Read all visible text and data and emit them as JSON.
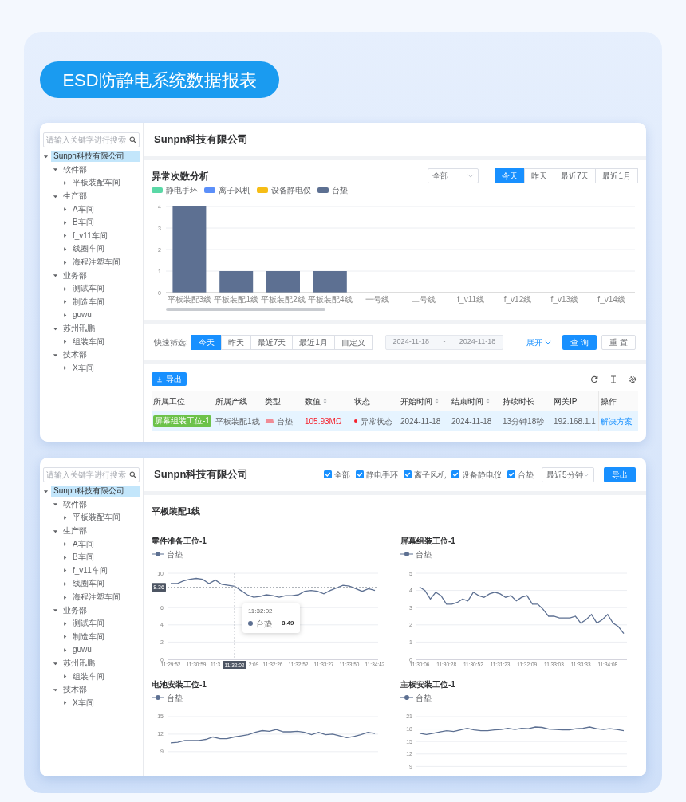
{
  "banner": {
    "title": "ESD防静电系统数据报表"
  },
  "screens": [
    {
      "kind": "analysis",
      "sidebar": {
        "search": {
          "placeholder": "请输入关键字进行搜索"
        },
        "tree": [
          {
            "label": "Sunpn科技有限公司",
            "expanded": true,
            "selected": true,
            "children": [
              {
                "label": "软件部",
                "expanded": true,
                "selected": false,
                "children": [
                  {
                    "label": "平板装配车间",
                    "expanded": false,
                    "selected": false
                  }
                ]
              },
              {
                "label": "生产部",
                "expanded": true,
                "selected": false,
                "children": [
                  {
                    "label": "A车间",
                    "expanded": false,
                    "selected": false
                  },
                  {
                    "label": "B车间",
                    "expanded": false,
                    "selected": false
                  },
                  {
                    "label": "f_v11车间",
                    "expanded": false,
                    "selected": false
                  },
                  {
                    "label": "线圈车间",
                    "expanded": false,
                    "selected": false
                  },
                  {
                    "label": "海程注塑车间",
                    "expanded": false,
                    "selected": false
                  }
                ]
              },
              {
                "label": "业务部",
                "expanded": true,
                "selected": false,
                "children": [
                  {
                    "label": "测试车间",
                    "expanded": false,
                    "selected": false
                  },
                  {
                    "label": "制造车间",
                    "expanded": false,
                    "selected": false
                  },
                  {
                    "label": "guwu",
                    "expanded": false,
                    "selected": false
                  }
                ]
              },
              {
                "label": "苏州讯鹏",
                "expanded": true,
                "selected": false,
                "children": [
                  {
                    "label": "组装车间",
                    "expanded": false,
                    "selected": false
                  }
                ]
              },
              {
                "label": "技术部",
                "expanded": true,
                "selected": false,
                "children": [
                  {
                    "label": "X车间",
                    "expanded": false,
                    "selected": false
                  }
                ]
              }
            ]
          }
        ]
      },
      "header": {
        "title": "Sunpn科技有限公司"
      },
      "chart_panel": {
        "title": "异常次数分析",
        "dropdown": "全部",
        "ranges": [
          {
            "label": "今天",
            "selected": true
          },
          {
            "label": "昨天",
            "selected": false
          },
          {
            "label": "最近7天",
            "selected": false
          },
          {
            "label": "最近1月",
            "selected": false
          }
        ],
        "chart_data": {
          "type": "bar",
          "stacked": true,
          "grid": true,
          "categories": [
            "平板装配3线",
            "平板装配1线",
            "平板装配2线",
            "平板装配4线",
            "一号线",
            "二号线",
            "f_v11线",
            "f_v12线",
            "f_v13线",
            "f_v14线"
          ],
          "series": [
            {
              "name": "静电手环",
              "color": "#5ad8a6",
              "values": [
                0,
                0,
                0,
                0,
                0,
                0,
                0,
                0,
                0,
                0
              ]
            },
            {
              "name": "离子风机",
              "color": "#5b8ff9",
              "values": [
                0,
                0,
                0,
                0,
                0,
                0,
                0,
                0,
                0,
                0
              ]
            },
            {
              "name": "设备静电仪",
              "color": "#f6bd16",
              "values": [
                0,
                0,
                0,
                0,
                0,
                0,
                0,
                0,
                0,
                0
              ]
            },
            {
              "name": "台垫",
              "color": "#5d7092",
              "values": [
                4,
                1,
                1,
                1,
                0,
                0,
                0,
                0,
                0,
                0
              ]
            }
          ],
          "ylim": [
            0,
            4
          ],
          "yticks": [
            0,
            1,
            2,
            3,
            4
          ]
        }
      },
      "filter": {
        "label": "快速筛选:",
        "ranges": [
          {
            "label": "今天",
            "selected": true
          },
          {
            "label": "昨天",
            "selected": false
          },
          {
            "label": "最近7天",
            "selected": false
          },
          {
            "label": "最近1月",
            "selected": false
          },
          {
            "label": "自定义",
            "selected": false
          }
        ],
        "date_range": {
          "start": "2024-11-18",
          "separator": "-",
          "end": "2024-11-18",
          "disabled": true
        },
        "expand": "展开",
        "query": "查 询",
        "reset": "重 置"
      },
      "table": {
        "export": "导出",
        "columns": [
          {
            "label": "所属工位",
            "sortable": false
          },
          {
            "label": "所属产线",
            "sortable": false
          },
          {
            "label": "类型",
            "sortable": false
          },
          {
            "label": "数值",
            "sortable": true
          },
          {
            "label": "状态",
            "sortable": false
          },
          {
            "label": "开始时间",
            "sortable": true
          },
          {
            "label": "结束时间",
            "sortable": true
          },
          {
            "label": "持续时长",
            "sortable": false
          },
          {
            "label": "网关IP",
            "sortable": false
          },
          {
            "label": "操作",
            "sortable": false
          }
        ],
        "rows": [
          {
            "alarm": true,
            "highlighted": true,
            "cells": [
              {
                "kind": "tag",
                "text": "屏幕组装工位-1"
              },
              {
                "kind": "text",
                "text": "平板装配1线"
              },
              {
                "kind": "type",
                "text": "台垫"
              },
              {
                "kind": "value",
                "text": "105.93MΩ"
              },
              {
                "kind": "status",
                "text": "异常状态"
              },
              {
                "kind": "text",
                "text": "2024-11-18"
              },
              {
                "kind": "text",
                "text": "2024-11-18"
              },
              {
                "kind": "text",
                "text": "13分钟18秒"
              },
              {
                "kind": "text",
                "text": "192.168.1.1"
              },
              {
                "kind": "link",
                "text": "解决方案"
              }
            ]
          }
        ]
      }
    },
    {
      "kind": "realtime",
      "sidebar": {
        "search": {
          "placeholder": "请输入关键字进行搜索"
        },
        "tree": [
          {
            "label": "Sunpn科技有限公司",
            "expanded": true,
            "selected": true,
            "children": [
              {
                "label": "软件部",
                "expanded": true,
                "selected": false,
                "children": [
                  {
                    "label": "平板装配车间",
                    "expanded": false,
                    "selected": false
                  }
                ]
              },
              {
                "label": "生产部",
                "expanded": true,
                "selected": false,
                "children": [
                  {
                    "label": "A车间",
                    "expanded": false,
                    "selected": false
                  },
                  {
                    "label": "B车间",
                    "expanded": false,
                    "selected": false
                  },
                  {
                    "label": "f_v11车间",
                    "expanded": false,
                    "selected": false
                  },
                  {
                    "label": "线圈车间",
                    "expanded": false,
                    "selected": false
                  },
                  {
                    "label": "海程注塑车间",
                    "expanded": false,
                    "selected": false
                  }
                ]
              },
              {
                "label": "业务部",
                "expanded": true,
                "selected": false,
                "children": [
                  {
                    "label": "测试车间",
                    "expanded": false,
                    "selected": false
                  },
                  {
                    "label": "制造车间",
                    "expanded": false,
                    "selected": false
                  },
                  {
                    "label": "guwu",
                    "expanded": false,
                    "selected": false
                  }
                ]
              },
              {
                "label": "苏州讯鹏",
                "expanded": true,
                "selected": false,
                "children": [
                  {
                    "label": "组装车间",
                    "expanded": false,
                    "selected": false
                  }
                ]
              },
              {
                "label": "技术部",
                "expanded": true,
                "selected": false,
                "children": [
                  {
                    "label": "X车间",
                    "expanded": false,
                    "selected": false
                  }
                ]
              }
            ]
          }
        ]
      },
      "header": {
        "title": "Sunpn科技有限公司",
        "filters": [
          {
            "label": "全部",
            "checked": true
          },
          {
            "label": "静电手环",
            "checked": true
          },
          {
            "label": "离子风机",
            "checked": true
          },
          {
            "label": "设备静电仪",
            "checked": true
          },
          {
            "label": "台垫",
            "checked": true
          }
        ],
        "dropdown": "最近5分钟",
        "export": "导出"
      },
      "section_title": "平板装配1线",
      "charts": [
        {
          "title": "零件准备工位-1",
          "tooltip": {
            "title": "11:32:02",
            "series": "台垫",
            "value": "8.49"
          },
          "chart_data": {
            "type": "line",
            "grid": true,
            "ylim": [
              0,
              10
            ],
            "yticks": [
              0,
              2,
              4,
              6,
              10
            ],
            "categories": [
              "11:29:52",
              null,
              null,
              null,
              "11:30:59",
              null,
              null,
              "11:3",
              null,
              null,
              "11:32:02",
              null,
              null,
              "2:09",
              null,
              null,
              "11:32:26",
              null,
              null,
              null,
              "11:32:52",
              null,
              null,
              null,
              "11:33:27",
              null,
              null,
              null,
              "11:33:50",
              null,
              null,
              null,
              "11:34:42"
            ],
            "series": [
              {
                "name": "台垫",
                "color": "#5d7092",
                "values": [
                  8.8,
                  8.8,
                  9.1,
                  9.3,
                  9.4,
                  9.3,
                  8.8,
                  9.2,
                  8.7,
                  8.6,
                  8.49,
                  8.0,
                  7.5,
                  7.2,
                  7.3,
                  7.5,
                  7.4,
                  7.2,
                  7.4,
                  7.4,
                  7.5,
                  7.9,
                  8.0,
                  7.9,
                  7.6,
                  8.0,
                  8.3,
                  8.6,
                  8.5,
                  8.2,
                  7.9,
                  8.2,
                  8.0
                ]
              }
            ],
            "ref_lines": [
              {
                "axis": "y",
                "value": 8.36,
                "label": "8.36"
              },
              {
                "axis": "x",
                "value": "11:32:02"
              }
            ]
          }
        },
        {
          "title": "屏幕组装工位-1",
          "chart_data": {
            "type": "line",
            "grid": true,
            "ylim": [
              0,
              5
            ],
            "yticks": [
              0,
              1,
              2,
              3,
              4,
              5
            ],
            "categories": [
              "11:30:06",
              null,
              null,
              null,
              null,
              "11:30:28",
              null,
              null,
              null,
              null,
              "11:30:52",
              null,
              null,
              null,
              null,
              "11:31:23",
              null,
              null,
              null,
              null,
              "11:32:09",
              null,
              null,
              null,
              null,
              "11:33:03",
              null,
              null,
              null,
              null,
              "11:33:33",
              null,
              null,
              null,
              null,
              "11:34:08",
              null,
              null,
              null
            ],
            "series": [
              {
                "name": "台垫",
                "color": "#5d7092",
                "values": [
                  4.2,
                  4.0,
                  3.5,
                  3.9,
                  3.7,
                  3.2,
                  3.2,
                  3.3,
                  3.5,
                  3.4,
                  3.9,
                  3.7,
                  3.6,
                  3.8,
                  3.9,
                  3.8,
                  3.6,
                  3.7,
                  3.4,
                  3.6,
                  3.7,
                  3.2,
                  3.2,
                  2.9,
                  2.5,
                  2.5,
                  2.4,
                  2.4,
                  2.4,
                  2.5,
                  2.1,
                  2.3,
                  2.6,
                  2.1,
                  2.3,
                  2.6,
                  2.1,
                  1.9,
                  1.5
                ]
              }
            ]
          }
        },
        {
          "title": "电池安装工位-1",
          "chart_data": {
            "type": "line",
            "grid": true,
            "ylim": [
              9,
              15
            ],
            "yticks": [
              9,
              12,
              15
            ],
            "series": [
              {
                "name": "台垫",
                "color": "#5d7092",
                "values": [
                  10.5,
                  10.6,
                  10.9,
                  10.9,
                  10.9,
                  11.1,
                  11.5,
                  11.2,
                  11.2,
                  11.5,
                  11.7,
                  11.9,
                  12.3,
                  12.6,
                  12.5,
                  12.8,
                  12.4,
                  12.4,
                  12.5,
                  12.3,
                  11.9,
                  12.3,
                  11.9,
                  12.0,
                  11.7,
                  11.4,
                  11.6,
                  11.9,
                  12.3,
                  12.1
                ]
              }
            ]
          }
        },
        {
          "title": "主板安装工位-1",
          "chart_data": {
            "type": "line",
            "grid": true,
            "ylim": [
              9,
              21
            ],
            "yticks": [
              9,
              12,
              15,
              18,
              21
            ],
            "series": [
              {
                "name": "台垫",
                "color": "#5d7092",
                "values": [
                  17.0,
                  16.7,
                  17.0,
                  17.3,
                  17.6,
                  17.4,
                  17.8,
                  18.2,
                  17.8,
                  17.6,
                  17.6,
                  17.8,
                  17.9,
                  18.2,
                  17.9,
                  18.2,
                  18.1,
                  18.5,
                  18.4,
                  18.0,
                  17.9,
                  17.8,
                  17.8,
                  18.1,
                  18.2,
                  18.5,
                  18.1,
                  17.9,
                  18.1,
                  17.9,
                  17.6
                ]
              }
            ]
          }
        }
      ]
    }
  ]
}
